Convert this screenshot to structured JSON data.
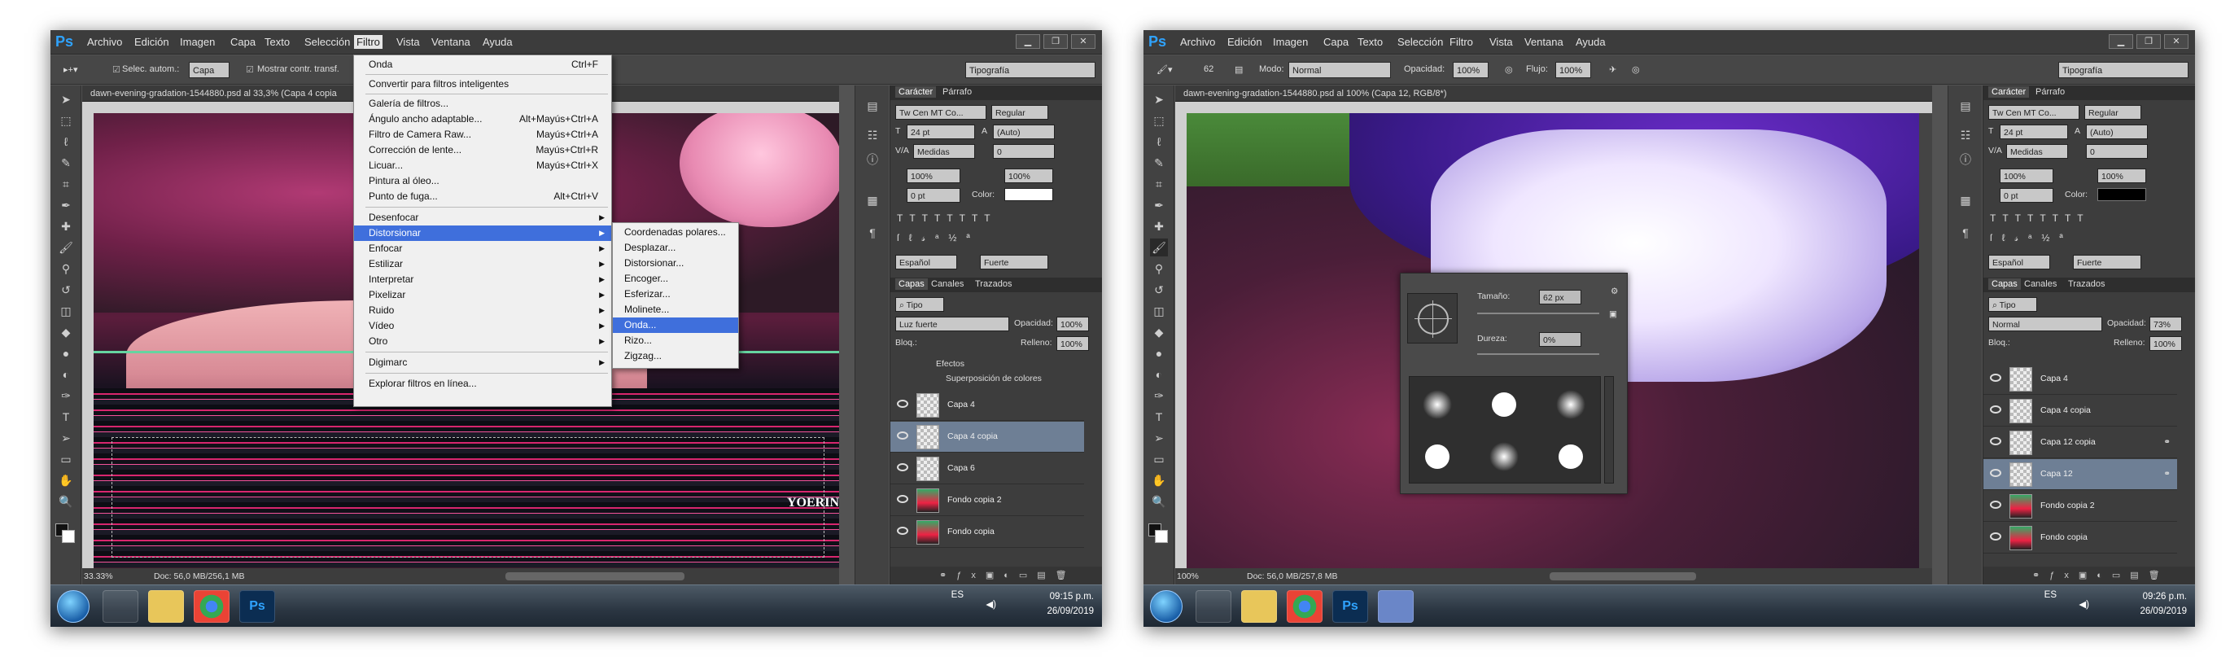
{
  "left": {
    "menu": [
      "Archivo",
      "Edición",
      "Imagen",
      "Capa",
      "Texto",
      "Selección",
      "Filtro",
      "Vista",
      "Ventana",
      "Ayuda"
    ],
    "options": {
      "autoselect": "Selec. autom.:",
      "layer": "Capa",
      "show_transform": "Mostrar contr. transf.",
      "workspace": "Tipografía"
    },
    "doc_tab": "dawn-evening-gradation-1544880.psd al 33,3% (Capa 4 copia",
    "canvas_text": "YOERINS",
    "zoom": "33.33%",
    "docsize": "Doc: 56,0 MB/256,1 MB",
    "filter_menu": [
      {
        "label": "Onda",
        "shortcut": "Ctrl+F"
      },
      {
        "label": "Convertir para filtros inteligentes",
        "shortcut": ""
      },
      {
        "label": "Galería de filtros...",
        "shortcut": ""
      },
      {
        "label": "Ángulo ancho adaptable...",
        "shortcut": "Alt+Mayús+Ctrl+A"
      },
      {
        "label": "Filtro de Camera Raw...",
        "shortcut": "Mayús+Ctrl+A"
      },
      {
        "label": "Corrección de lente...",
        "shortcut": "Mayús+Ctrl+R"
      },
      {
        "label": "Licuar...",
        "shortcut": "Mayús+Ctrl+X"
      },
      {
        "label": "Pintura al óleo...",
        "shortcut": ""
      },
      {
        "label": "Punto de fuga...",
        "shortcut": "Alt+Ctrl+V"
      },
      {
        "label": "Desenfocar",
        "shortcut": ""
      },
      {
        "label": "Distorsionar",
        "shortcut": ""
      },
      {
        "label": "Enfocar",
        "shortcut": ""
      },
      {
        "label": "Estilizar",
        "shortcut": ""
      },
      {
        "label": "Interpretar",
        "shortcut": ""
      },
      {
        "label": "Pixelizar",
        "shortcut": ""
      },
      {
        "label": "Ruido",
        "shortcut": ""
      },
      {
        "label": "Vídeo",
        "shortcut": ""
      },
      {
        "label": "Otro",
        "shortcut": ""
      },
      {
        "label": "Digimarc",
        "shortcut": ""
      },
      {
        "label": "Explorar filtros en línea...",
        "shortcut": ""
      }
    ],
    "distort_menu": [
      "Coordenadas polares...",
      "Desplazar...",
      "Distorsionar...",
      "Encoger...",
      "Esferizar...",
      "Molinete...",
      "Onda...",
      "Rizo...",
      "Zigzag..."
    ],
    "char_panel": {
      "tabs": [
        "Carácter",
        "Párrafo"
      ],
      "font": "Tw Cen MT Co...",
      "style": "Regular",
      "size": "24 pt",
      "leading": "(Auto)",
      "kerning": "Medidas",
      "tracking": "0",
      "vscale": "100%",
      "hscale": "100%",
      "baseline": "0 pt",
      "color_label": "Color:",
      "lang": "Español",
      "aa": "Fuerte"
    },
    "layers_panel": {
      "tabs": [
        "Capas",
        "Canales",
        "Trazados"
      ],
      "filter": "Tipo",
      "blend": "Luz fuerte",
      "opacity_label": "Opacidad:",
      "opacity": "100%",
      "lock_label": "Bloq.:",
      "fill_label": "Relleno:",
      "fill": "100%",
      "effects": "Efectos",
      "overlay": "Superposición de colores",
      "layers": [
        "Capa 4",
        "Capa 4 copia",
        "Capa 6",
        "Fondo copia 2",
        "Fondo copia"
      ]
    },
    "clock": {
      "time": "09:15 p.m.",
      "date": "26/09/2019",
      "lang": "ES"
    }
  },
  "right": {
    "menu": [
      "Archivo",
      "Edición",
      "Imagen",
      "Capa",
      "Texto",
      "Selección",
      "Filtro",
      "Vista",
      "Ventana",
      "Ayuda"
    ],
    "options": {
      "brush_size": "62",
      "mode_label": "Modo:",
      "mode": "Normal",
      "opacity_label": "Opacidad:",
      "opacity": "100%",
      "flow_label": "Flujo:",
      "flow": "100%",
      "workspace": "Tipografía"
    },
    "doc_tab": "dawn-evening-gradation-1544880.psd al 100% (Capa 12, RGB/8*)",
    "zoom": "100%",
    "docsize": "Doc: 56,0 MB/257,8 MB",
    "brush_popup": {
      "size_label": "Tamaño:",
      "size": "62 px",
      "hardness_label": "Dureza:",
      "hardness": "0%"
    },
    "char_panel": {
      "tabs": [
        "Carácter",
        "Párrafo"
      ],
      "font": "Tw Cen MT Co...",
      "style": "Regular",
      "size": "24 pt",
      "leading": "(Auto)",
      "kerning": "Medidas",
      "tracking": "0",
      "vscale": "100%",
      "hscale": "100%",
      "baseline": "0 pt",
      "color_label": "Color:",
      "lang": "Español",
      "aa": "Fuerte"
    },
    "layers_panel": {
      "tabs": [
        "Capas",
        "Canales",
        "Trazados"
      ],
      "filter": "Tipo",
      "blend": "Normal",
      "opacity_label": "Opacidad:",
      "opacity": "73%",
      "lock_label": "Bloq.:",
      "fill_label": "Relleno:",
      "fill": "100%",
      "layers": [
        "Capa 4",
        "Capa 4 copia",
        "Capa 12 copia",
        "Capa 12",
        "Fondo copia 2",
        "Fondo copia"
      ]
    },
    "clock": {
      "time": "09:26 p.m.",
      "date": "26/09/2019",
      "lang": "ES"
    }
  },
  "colors": {
    "ps_blue": "#2fa3ff",
    "menu_highlight": "#3f6fdc",
    "selected_layer": "#6e7f95"
  }
}
